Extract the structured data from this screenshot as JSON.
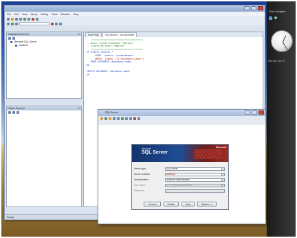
{
  "colors": {
    "desktop_sky": "#2e5bb7",
    "desktop_field": "#c4a45a",
    "window_frame": "#dbe3ef",
    "banner_blue": "#1f4d95",
    "banner_red": "#9e2c24",
    "sidebar": "#2a2a2a"
  },
  "sidebar": {
    "title": "Side Gadgets",
    "time_text": "5:24 AM, Nov 21"
  },
  "main_window": {
    "menu": [
      "File",
      "Edit",
      "View",
      "Query",
      "Debug",
      "Tools",
      "Window",
      "Help"
    ],
    "object_explorer": {
      "title": "Registered Servers",
      "server_node": "Microsoft SQL Server",
      "instance_node": "localhost"
    },
    "template_explorer": {
      "title": "Object Explorer"
    },
    "tabs": [
      "Start Page",
      "SQLQuery1 - not connected"
    ],
    "code_lines": [
      {
        "text": "-- =====================================",
        "cls": "c-green"
      },
      {
        "text": "-- Basic Create Database Template",
        "cls": "c-green"
      },
      {
        "text": "-- Create_DB_Basic.template",
        "cls": "c-green"
      },
      {
        "text": "-- =====================================",
        "cls": "c-green"
      },
      {
        "text": "IF EXISTS (SELECT *",
        "cls": "c-blue"
      },
      {
        "text": "      FROM   master..sysdatabases",
        "cls": "c-blue"
      },
      {
        "text": "      WHERE  [name] = N'<database_name>')",
        "cls": "c-red"
      },
      {
        "text": "   DROP DATABASE <database_name>",
        "cls": "c-blue"
      },
      {
        "text": "GO",
        "cls": "c-blue"
      },
      {
        "text": "",
        "cls": ""
      },
      {
        "text": "CREATE DATABASE <database_name>",
        "cls": "c-blue"
      },
      {
        "text": "GO",
        "cls": "c-blue"
      }
    ],
    "status_left": "Ready",
    "status_right": "Connected: 0"
  },
  "dialog": {
    "title": "SQL Server",
    "connect": {
      "banner_ms": "Microsoft",
      "banner_product": "SQL Server",
      "banner_brand": "Microsoft",
      "fields": [
        {
          "label": "Server type:",
          "value": "SQL Server",
          "disabled": false
        },
        {
          "label": "Server instance:",
          "value": "localhost",
          "disabled": false
        },
        {
          "label": "Authentication:",
          "value": "Windows Authentication",
          "disabled": false
        },
        {
          "label": "User name:",
          "value": "MY-DOMAIN\\Administrator",
          "disabled": true
        },
        {
          "label": "Password:",
          "value": "",
          "disabled": true
        }
      ],
      "buttons": [
        "Connect",
        "Cancel",
        "Help",
        "Options >>"
      ]
    }
  }
}
